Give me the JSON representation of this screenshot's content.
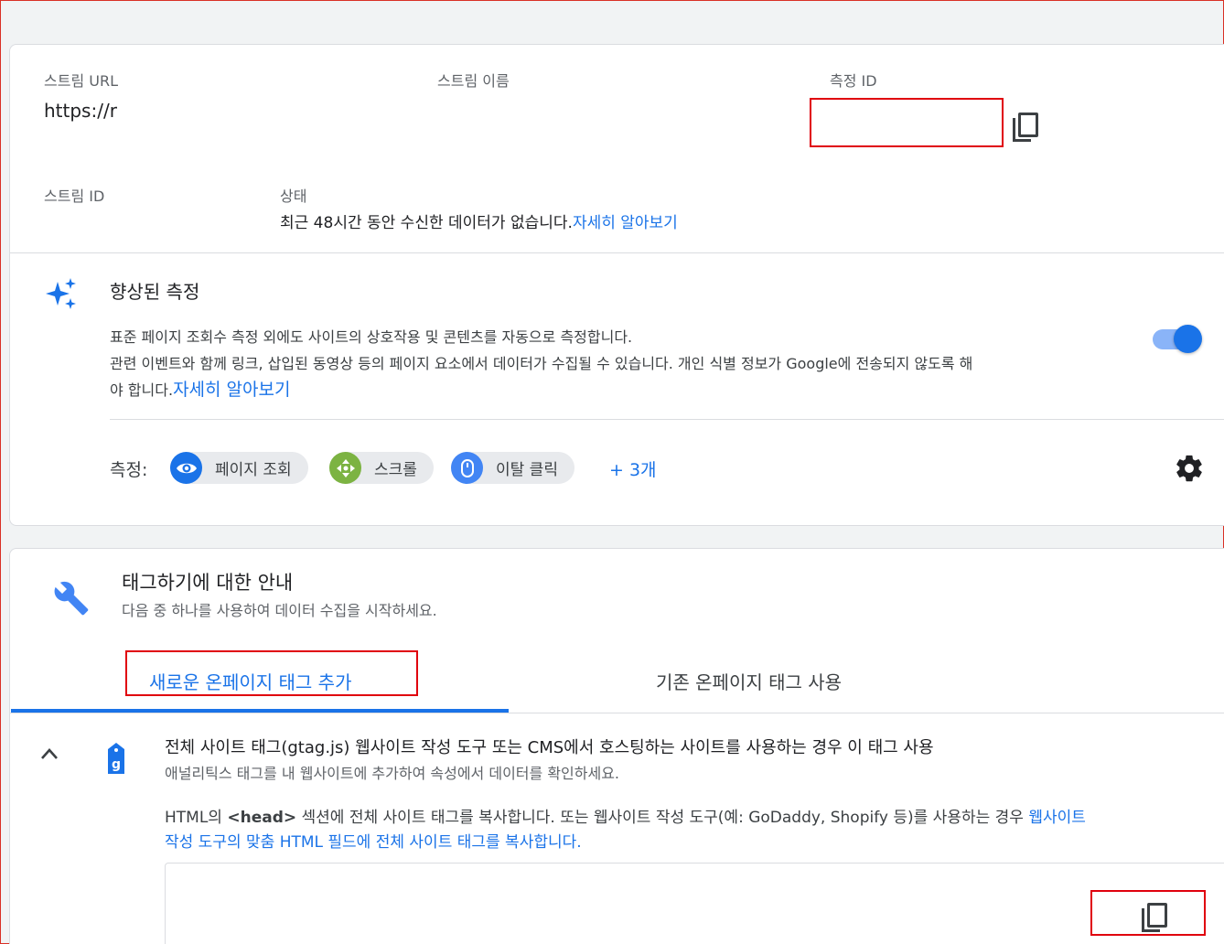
{
  "stream_details": {
    "stream_url_label": "스트림 URL",
    "stream_url_value": "https://r",
    "stream_name_label": "스트림 이름",
    "measurement_id_label": "측정 ID",
    "stream_id_label": "스트림 ID",
    "status_label": "상태",
    "status_text": "최근 48시간 동안 수신한 데이터가 없습니다.",
    "status_link": "자세히 알아보기"
  },
  "enhanced_measurement": {
    "title": "향상된 측정",
    "desc_line1": "표준 페이지 조회수 측정 외에도 사이트의 상호작용 및 콘텐츠를 자동으로 측정합니다.",
    "desc_line2": "관련 이벤트와 함께 링크, 삽입된 동영상 등의 페이지 요소에서 데이터가 수집될 수 있습니다. 개인 식별 정보가 Google에 전송되지 않도록 해",
    "desc_line3": "야 합니다.",
    "desc_link": "자세히 알아보기",
    "toggle_on": true,
    "measuring_label": "측정:",
    "chips": [
      {
        "label": "페이지 조회",
        "icon": "eye-icon",
        "color": "#1a73e8"
      },
      {
        "label": "스크롤",
        "icon": "scroll-arrows-icon",
        "color": "#7cb342"
      },
      {
        "label": "이탈 클릭",
        "icon": "mouse-icon",
        "color": "#4285f4"
      }
    ],
    "more_label": "+ 3개"
  },
  "tagging": {
    "title": "태그하기에 대한 안내",
    "subtitle": "다음 중 하나를 사용하여 데이터 수집을 시작하세요.",
    "tabs": [
      {
        "label": "새로운 온페이지 태그 추가",
        "active": true
      },
      {
        "label": "기존 온페이지 태그 사용",
        "active": false
      }
    ],
    "gtag": {
      "title": "전체 사이트 태그(gtag.js) 웹사이트 작성 도구 또는 CMS에서 호스팅하는 사이트를 사용하는 경우 이 태그 사용",
      "subtitle": "애널리틱스 태그를 내 웹사이트에 추가하여 속성에서 데이터를 확인하세요.",
      "instr_pre": "HTML의 ",
      "instr_bold": "<head>",
      "instr_mid": " 섹션에 전체 사이트 태그를 복사합니다. 또는 웹사이트 작성 도구(예: GoDaddy, Shopify 등)를 사용하는 경우 ",
      "instr_link1": "웹사이트",
      "instr_link2": "작성 도구의 맞춤 HTML 필드에 전체 사이트 태그를 복사합니다."
    }
  },
  "colors": {
    "accent": "#1a73e8",
    "highlight_box": "#e0000d"
  }
}
